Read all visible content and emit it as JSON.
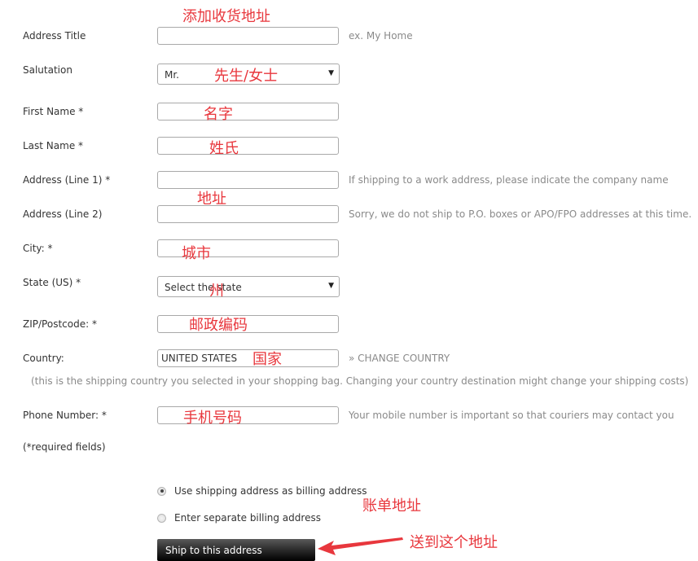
{
  "form": {
    "address_title": {
      "label": "Address Title",
      "value": "",
      "hint": "ex. My Home"
    },
    "salutation": {
      "label": "Salutation",
      "selected": "Mr."
    },
    "first_name": {
      "label": "First Name *",
      "value": ""
    },
    "last_name": {
      "label": "Last Name *",
      "value": ""
    },
    "address_line1": {
      "label": "Address (Line 1) *",
      "value": "",
      "hint": "If shipping to a work address, please indicate the company name"
    },
    "address_line2": {
      "label": "Address (Line 2)",
      "value": "",
      "hint": "Sorry, we do not ship to P.O. boxes or APO/FPO addresses at this time."
    },
    "city": {
      "label": "City: *",
      "value": ""
    },
    "state": {
      "label": "State (US) *",
      "selected": "Select the state"
    },
    "zip": {
      "label": "ZIP/Postcode: *",
      "value": ""
    },
    "country": {
      "label": "Country:",
      "value": "UNITED STATES",
      "change_link": "» CHANGE COUNTRY",
      "note": "(this is the shipping country you selected in your shopping bag. Changing your country destination might change your shipping costs)"
    },
    "phone": {
      "label": "Phone Number: *",
      "value": "",
      "hint": "Your mobile number is important so that couriers may contact you"
    },
    "required_note": "(*required fields)"
  },
  "billing": {
    "options": [
      {
        "label": "Use shipping address as billing address",
        "checked": true
      },
      {
        "label": "Enter separate billing address",
        "checked": false
      }
    ]
  },
  "submit_label": "Ship to this address",
  "annotations": {
    "add_address": "添加收货地址",
    "salutation": "先生/女士",
    "first_name": "名字",
    "last_name": "姓氏",
    "address": "地址",
    "city": "城市",
    "state": "州",
    "zip": "邮政编码",
    "country": "国家",
    "phone": "手机号码",
    "billing": "账单地址",
    "ship": "送到这个地址"
  },
  "colors": {
    "annotation": "#e8373d",
    "hint": "#8a8a8a"
  }
}
